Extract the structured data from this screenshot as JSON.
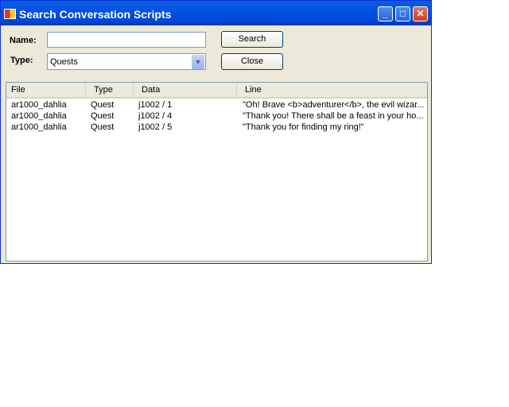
{
  "window": {
    "title": "Search Conversation Scripts"
  },
  "form": {
    "name_label": "Name:",
    "name_value": "",
    "type_label": "Type:",
    "type_value": "Quests",
    "search_label": "Search",
    "close_label": "Close"
  },
  "list": {
    "columns": [
      "File",
      "Type",
      "Data",
      "Line"
    ],
    "rows": [
      {
        "file": "ar1000_dahlia",
        "type": "Quest",
        "data": "j1002 / 1",
        "line": "\"Oh! Brave <b>adventurer</b>, the evil wizar..."
      },
      {
        "file": "ar1000_dahlia",
        "type": "Quest",
        "data": "j1002 / 4",
        "line": "\"Thank you! There shall be a feast in your ho..."
      },
      {
        "file": "ar1000_dahlia",
        "type": "Quest",
        "data": "j1002 / 5",
        "line": "\"Thank you for finding my ring!\""
      }
    ]
  }
}
